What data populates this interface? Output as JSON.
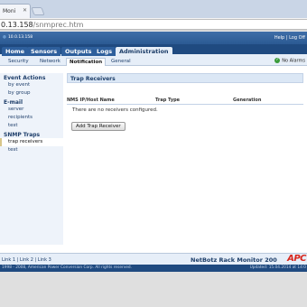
{
  "browser": {
    "tab_title": "Moni",
    "url_host": "0.13.158",
    "url_path": "/snmprec.htm"
  },
  "header": {
    "ip": "10.0.13.158",
    "help": "Help",
    "log_off": "Log Off",
    "separator": " | "
  },
  "nav": {
    "tabs": [
      {
        "label": "Home"
      },
      {
        "label": "Sensors"
      },
      {
        "label": "Outputs"
      },
      {
        "label": "Logs"
      },
      {
        "label": "Administration"
      }
    ]
  },
  "subnav": {
    "tabs": [
      {
        "label": "Security"
      },
      {
        "label": "Network"
      },
      {
        "label": "Notification"
      },
      {
        "label": "General"
      }
    ],
    "alarm_status": "No Alarms"
  },
  "sidebar": {
    "sections": [
      {
        "heading": "Event Actions",
        "items": [
          "by event",
          "by group"
        ]
      },
      {
        "heading": "E-mail",
        "items": [
          "server",
          "recipients",
          "test"
        ]
      },
      {
        "heading": "SNMP Traps",
        "items": [
          "trap receivers",
          "test"
        ]
      }
    ]
  },
  "main": {
    "title": "Trap Receivers",
    "columns": [
      "NMS IP/Host Name",
      "Trap Type",
      "Generation"
    ],
    "empty_message": "There are no receivers configured.",
    "add_button": "Add Trap Receiver"
  },
  "footer": {
    "links": [
      "Link 1",
      "Link 2",
      "Link 3"
    ],
    "link_separator": " | ",
    "product": "NetBotz Rack Monitor 200",
    "logo": "APC",
    "copyright": "1998 - 2008, American Power Conversion Corp. All rights reserved.",
    "updated": "Updated: 15.04.2014 at 14:0"
  },
  "colors": {
    "header_blue": "#2b5a93",
    "nav_blue": "#1f4a80",
    "accent_red": "#d8261c",
    "ok_green": "#3a9b3a"
  }
}
